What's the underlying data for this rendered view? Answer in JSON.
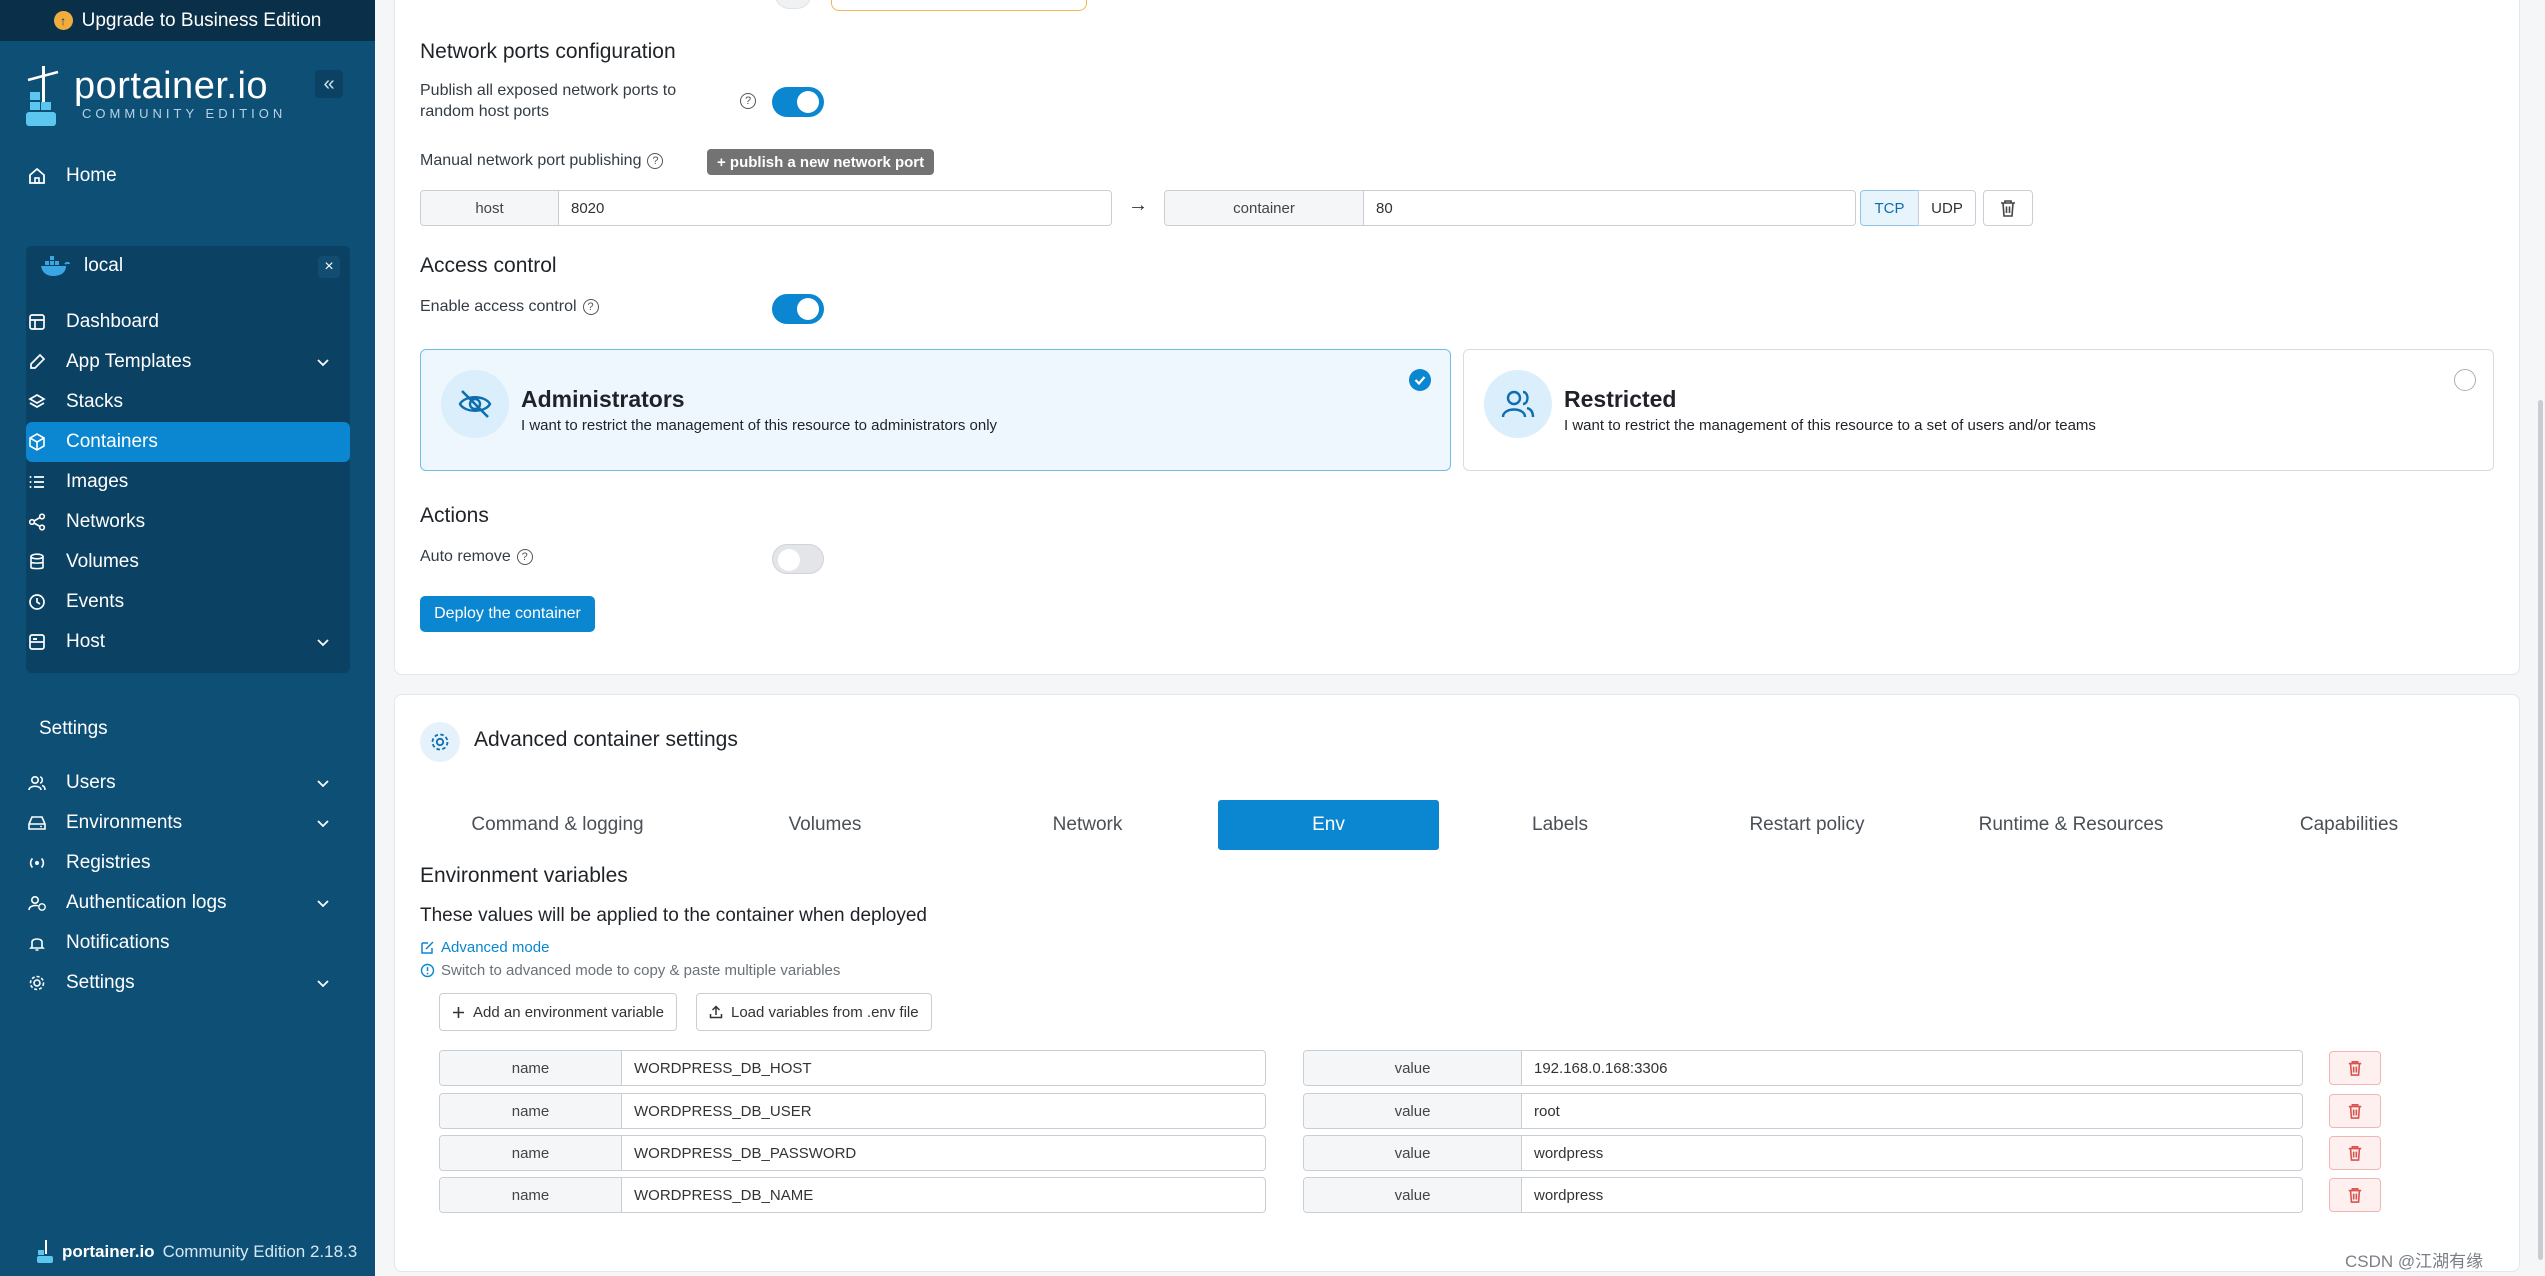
{
  "colors": {
    "sidebar": "#0e4f76",
    "accent": "#0b86d0",
    "danger": "#e35b5b"
  },
  "sidebar": {
    "upgrade_label": "Upgrade to Business Edition",
    "brand": "portainer.io",
    "edition": "COMMUNITY EDITION",
    "home": "Home",
    "env_name": "local",
    "env_items": [
      {
        "label": "Dashboard",
        "icon": "dashboard-icon"
      },
      {
        "label": "App Templates",
        "icon": "edit-icon"
      },
      {
        "label": "Stacks",
        "icon": "layers-icon"
      },
      {
        "label": "Containers",
        "icon": "box-icon"
      },
      {
        "label": "Images",
        "icon": "list-icon"
      },
      {
        "label": "Networks",
        "icon": "share-icon"
      },
      {
        "label": "Volumes",
        "icon": "database-icon"
      },
      {
        "label": "Events",
        "icon": "clock-icon"
      },
      {
        "label": "Host",
        "icon": "server-icon"
      }
    ],
    "settings_title": "Settings",
    "settings_items": [
      {
        "label": "Users",
        "icon": "users-icon"
      },
      {
        "label": "Environments",
        "icon": "hdd-icon"
      },
      {
        "label": "Registries",
        "icon": "radio-icon"
      },
      {
        "label": "Authentication logs",
        "icon": "user-clock-icon"
      },
      {
        "label": "Notifications",
        "icon": "bell-icon"
      },
      {
        "label": "Settings",
        "icon": "gear-icon"
      }
    ],
    "footer_brand": "portainer.io",
    "footer_version": "Community Edition 2.18.3"
  },
  "network": {
    "title": "Network ports configuration",
    "publish_all_label": "Publish all exposed network ports to random host ports",
    "publish_all_on": true,
    "manual_label": "Manual network port publishing",
    "publish_btn": "+ publish a new network port",
    "host_addon": "host",
    "host_value": "8020",
    "container_addon": "container",
    "container_value": "80",
    "tcp": "TCP",
    "udp": "UDP",
    "arrow": "→"
  },
  "access": {
    "title": "Access control",
    "enable_label": "Enable access control",
    "enabled": true,
    "admin_title": "Administrators",
    "admin_desc": "I want to restrict the management of this resource to administrators only",
    "restricted_title": "Restricted",
    "restricted_desc": "I want to restrict the management of this resource to a set of users and/or teams"
  },
  "actions": {
    "title": "Actions",
    "auto_remove_label": "Auto remove",
    "auto_remove_on": false,
    "deploy_label": "Deploy the container"
  },
  "advanced": {
    "title": "Advanced container settings",
    "tabs": [
      "Command & logging",
      "Volumes",
      "Network",
      "Env",
      "Labels",
      "Restart policy",
      "Runtime & Resources",
      "Capabilities"
    ],
    "active_tab": "Env",
    "env_title": "Environment variables",
    "env_subtitle": "These values will be applied to the container when deployed",
    "advanced_mode": "Advanced mode",
    "advanced_hint": "Switch to advanced mode to copy & paste multiple variables",
    "add_btn": "Add an environment variable",
    "load_btn": "Load variables from .env file",
    "name_addon": "name",
    "value_addon": "value",
    "vars": [
      {
        "name": "WORDPRESS_DB_HOST",
        "value": "192.168.0.168:3306"
      },
      {
        "name": "WORDPRESS_DB_USER",
        "value": "root"
      },
      {
        "name": "WORDPRESS_DB_PASSWORD",
        "value": "wordpress"
      },
      {
        "name": "WORDPRESS_DB_NAME",
        "value": "wordpress"
      }
    ]
  },
  "watermark": "CSDN @江湖有缘"
}
